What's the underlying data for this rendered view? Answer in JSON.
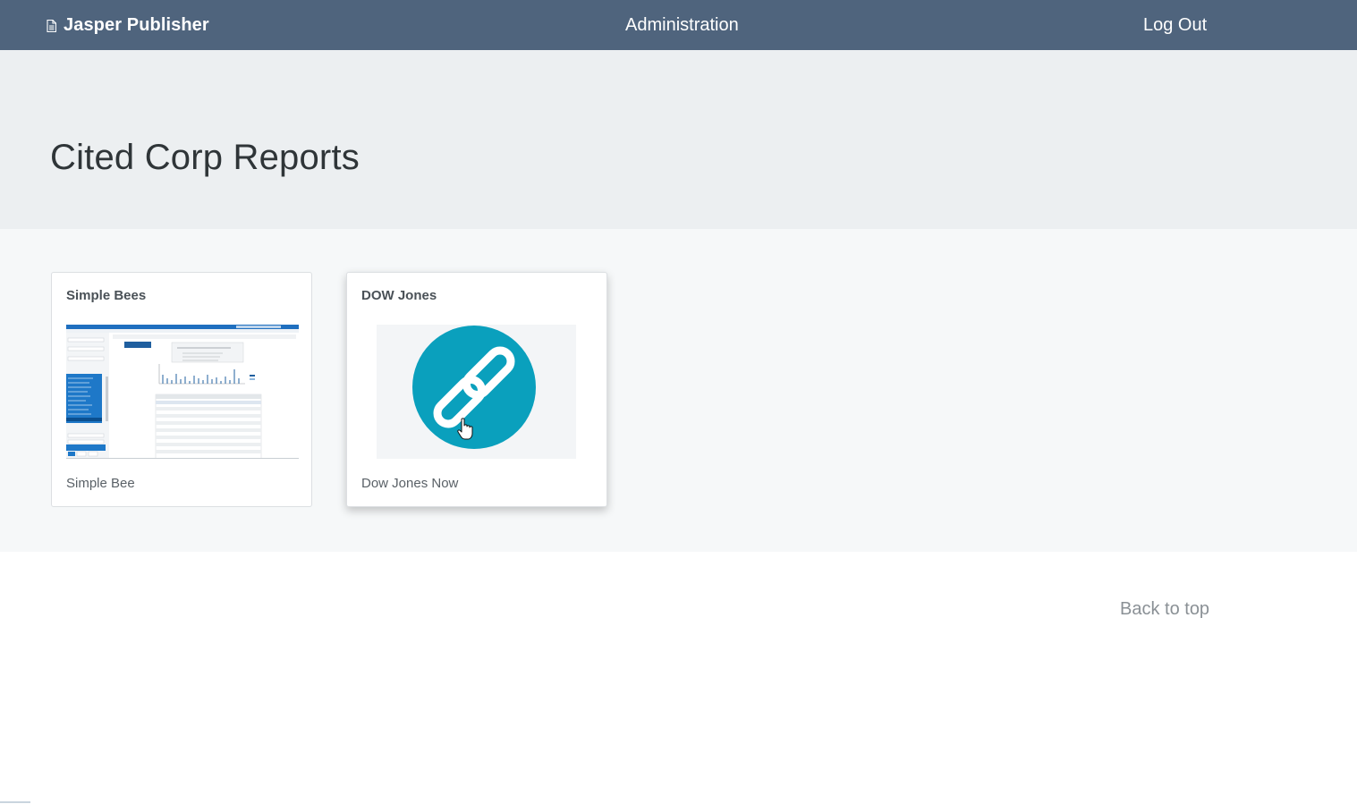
{
  "navbar": {
    "brand": "Jasper Publisher",
    "brand_icon": "document-icon",
    "administration": "Administration",
    "logout": "Log Out",
    "bg_color": "#4f647d"
  },
  "page": {
    "title": "Cited Corp Reports"
  },
  "cards": [
    {
      "title": "Simple Bees",
      "thumbnail": "report-screenshot-thumbnail",
      "text": "Simple Bee"
    },
    {
      "title": "DOW Jones",
      "thumbnail": "link-icon",
      "text": "Dow Jones Now",
      "accent": "#0aa0bd"
    }
  ],
  "footer": {
    "back_to_top": "Back to top"
  }
}
